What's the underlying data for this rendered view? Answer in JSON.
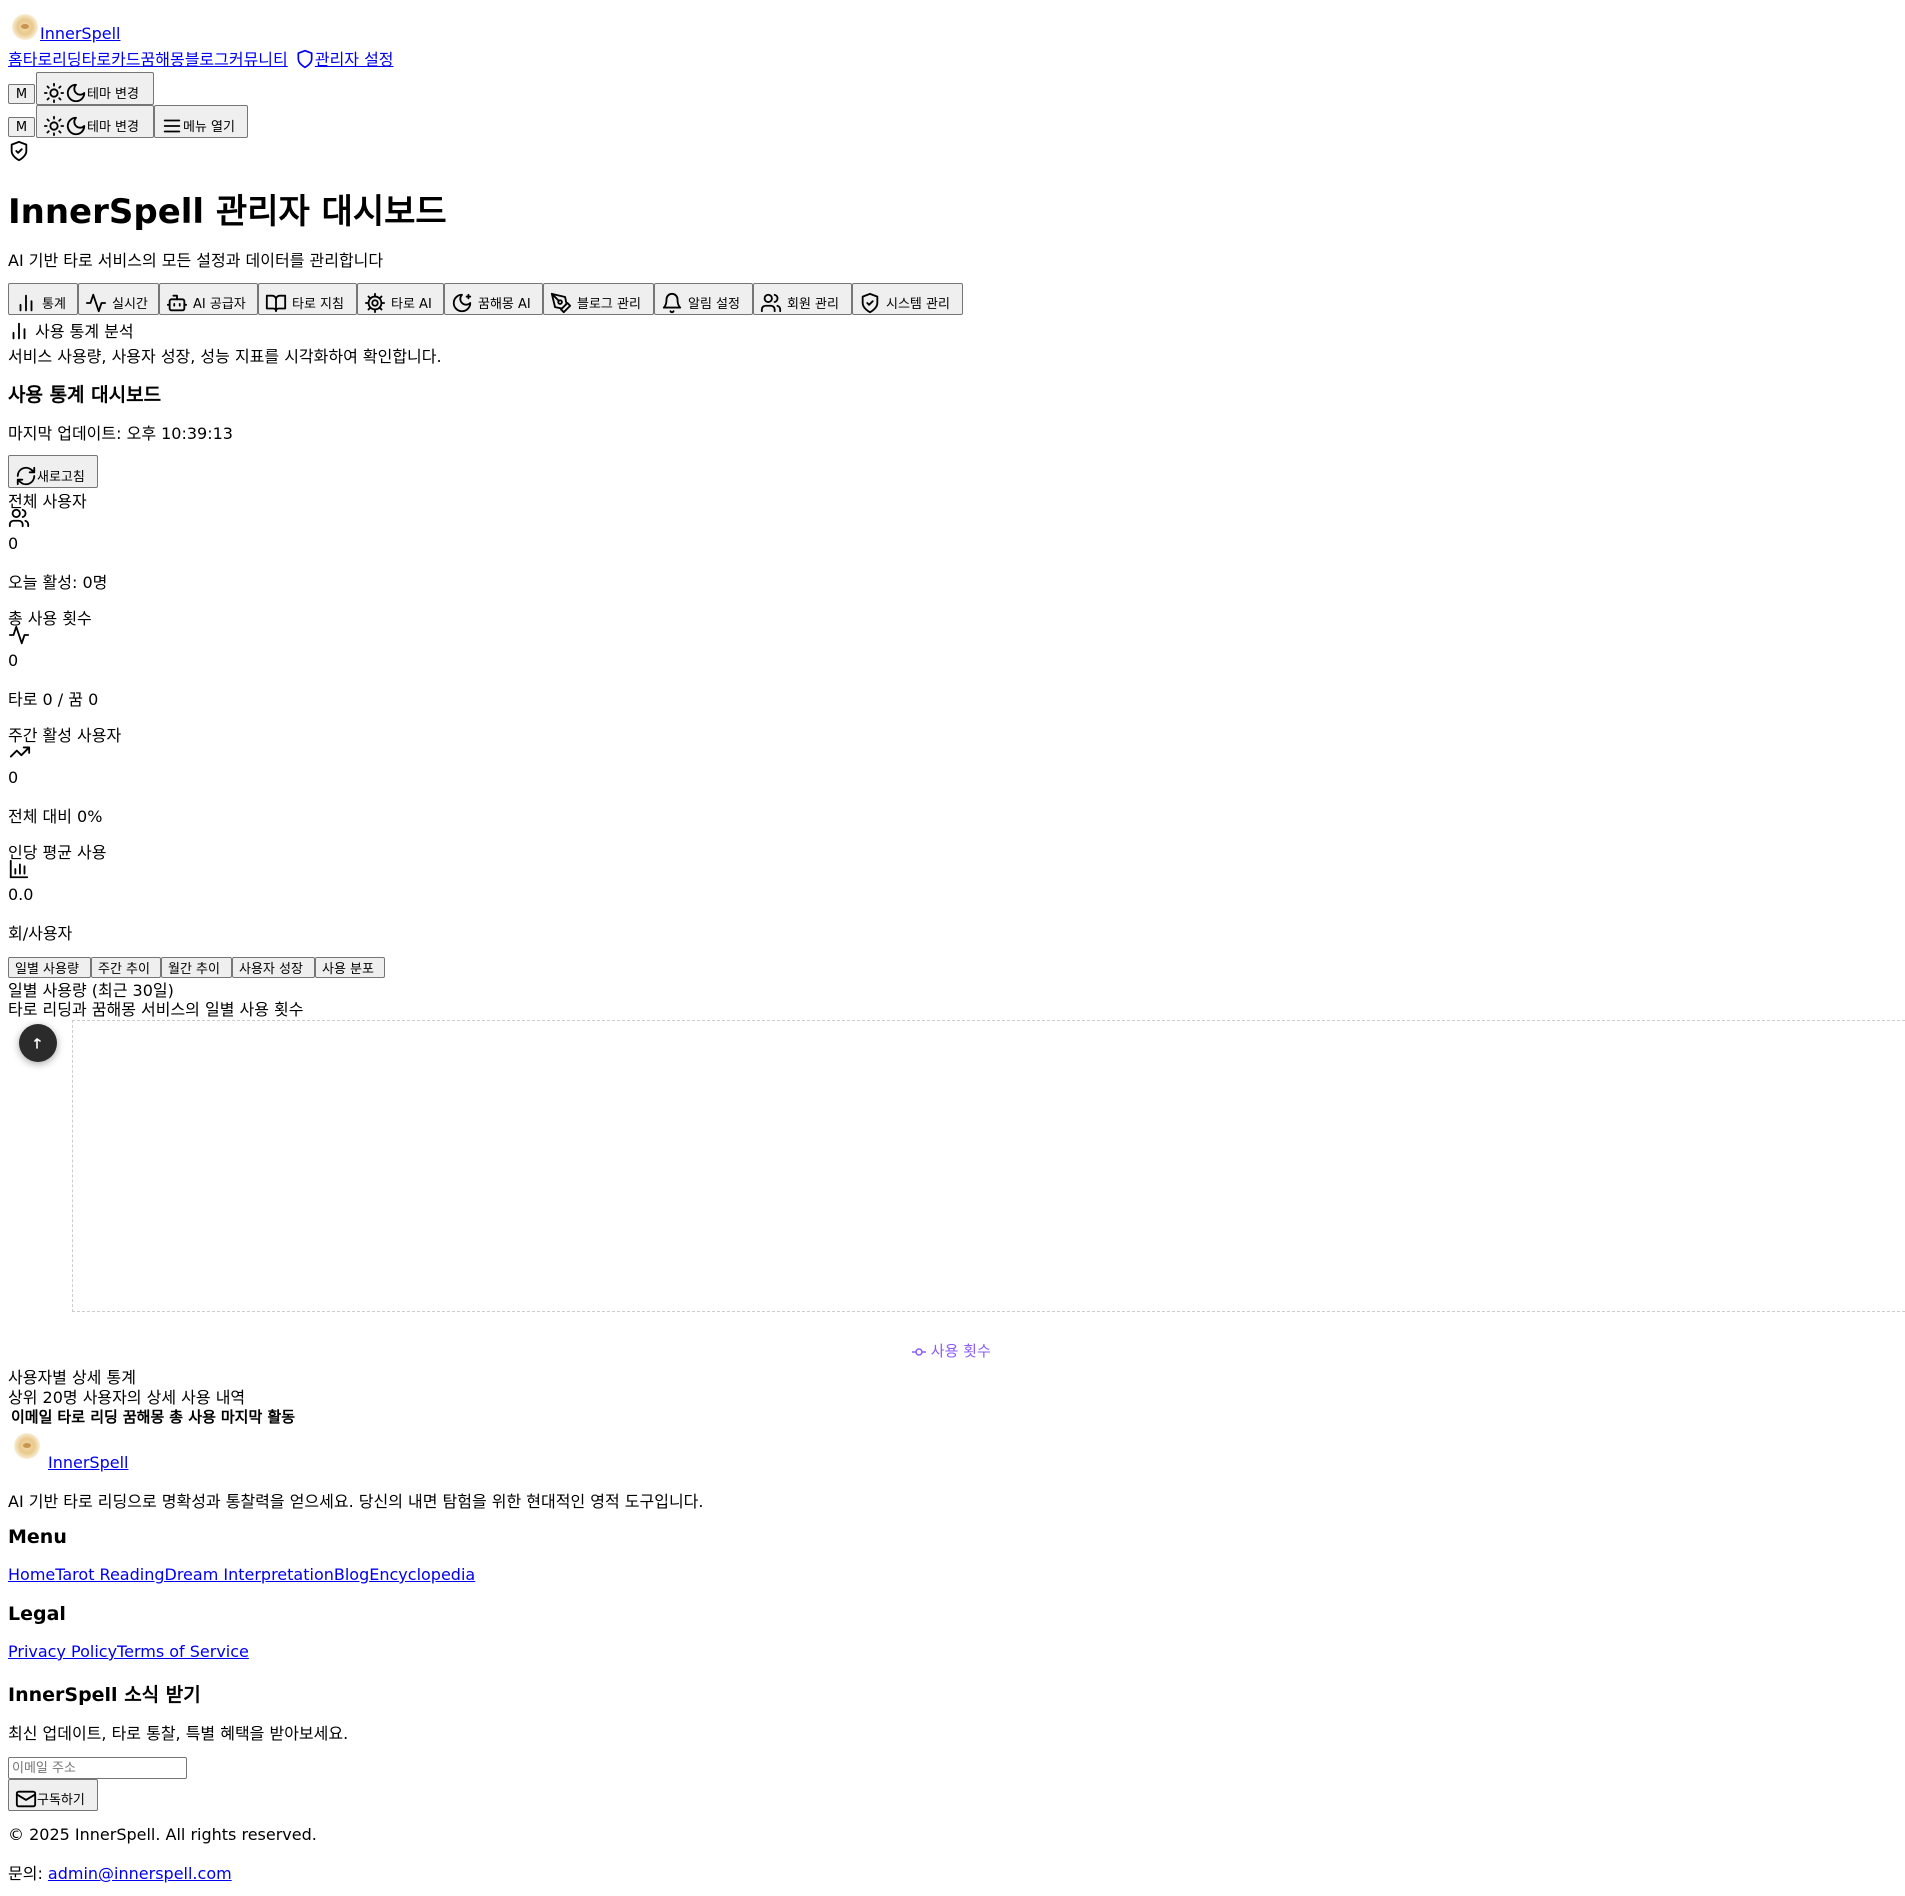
{
  "header": {
    "brand": "InnerSpell",
    "nav": [
      "홈",
      "타로리딩",
      "타로카드",
      "꿈해몽",
      "블로그",
      "커뮤니티"
    ],
    "admin_link": "관리자 설정",
    "avatar_letter": "M",
    "theme_label": "테마 변경",
    "menu_label": "메뉴 열기"
  },
  "page": {
    "title": "InnerSpell 관리자 대시보드",
    "subtitle": "AI 기반 타로 서비스의 모든 설정과 데이터를 관리합니다"
  },
  "admin_tabs": [
    {
      "label": "통계",
      "icon": "bar-chart-icon"
    },
    {
      "label": "실시간",
      "icon": "activity-icon"
    },
    {
      "label": "AI 공급자",
      "icon": "bot-icon"
    },
    {
      "label": "타로 지침",
      "icon": "book-open-icon"
    },
    {
      "label": "타로 AI",
      "icon": "gear-icon"
    },
    {
      "label": "꿈해몽 AI",
      "icon": "moon-star-icon"
    },
    {
      "label": "블로그 관리",
      "icon": "pen-tool-icon"
    },
    {
      "label": "알림 설정",
      "icon": "bell-icon"
    },
    {
      "label": "회원 관리",
      "icon": "users-icon"
    },
    {
      "label": "시스템 관리",
      "icon": "shield-check-icon"
    }
  ],
  "stats_section": {
    "card_title": "사용 통계 분석",
    "card_description": "서비스 사용량, 사용자 성장, 성능 지표를 시각화하여 확인합니다.",
    "dashboard_title": "사용 통계 대시보드",
    "last_update": "마지막 업데이트: 오후 10:39:13",
    "refresh_label": "새로고침"
  },
  "metrics": [
    {
      "label": "전체 사용자",
      "icon": "users-icon",
      "value": "0",
      "sub": "오늘 활성: 0명"
    },
    {
      "label": "총 사용 횟수",
      "icon": "activity-icon",
      "value": "0",
      "sub": "타로 0 / 꿈 0"
    },
    {
      "label": "주간 활성 사용자",
      "icon": "trending-up-icon",
      "value": "0",
      "sub": "전체 대비 0%"
    },
    {
      "label": "인당 평균 사용",
      "icon": "bar-chart-icon",
      "value": "0.0",
      "sub": "회/사용자"
    }
  ],
  "chart_tabs": [
    "일별 사용량",
    "주간 추이",
    "월간 추이",
    "사용자 성장",
    "사용 분포"
  ],
  "daily_chart": {
    "title": "일별 사용량 (최근 30일)",
    "description": "타로 리딩과 꿈해몽 서비스의 일별 사용 횟수",
    "legend_label": "사용 횟수",
    "legend_color": "#8b5cf6"
  },
  "user_stats": {
    "title": "사용자별 상세 통계",
    "description": "상위 20명 사용자의 상세 사용 내역",
    "columns": [
      "이메일",
      "타로 리딩",
      "꿈해몽",
      "총 사용",
      "마지막 활동"
    ]
  },
  "footer": {
    "brand": "InnerSpell",
    "tagline": "AI 기반 타로 리딩으로 명확성과 통찰력을 얻으세요. 당신의 내면 탐험을 위한 현대적인 영적 도구입니다.",
    "menu_heading": "Menu",
    "menu_links": [
      "Home",
      "Tarot Reading",
      "Dream Interpretation",
      "Blog",
      "Encyclopedia"
    ],
    "legal_heading": "Legal",
    "legal_links": [
      "Privacy Policy",
      "Terms of Service"
    ],
    "newsletter_heading": "InnerSpell 소식 받기",
    "newsletter_text": "최신 업데이트, 타로 통찰, 특별 혜택을 받아보세요.",
    "email_placeholder": "이메일 주소",
    "subscribe_label": "구독하기",
    "copyright": "© 2025 InnerSpell. All rights reserved.",
    "contact_prefix": "문의: ",
    "contact_email": "admin@innerspell.com"
  }
}
